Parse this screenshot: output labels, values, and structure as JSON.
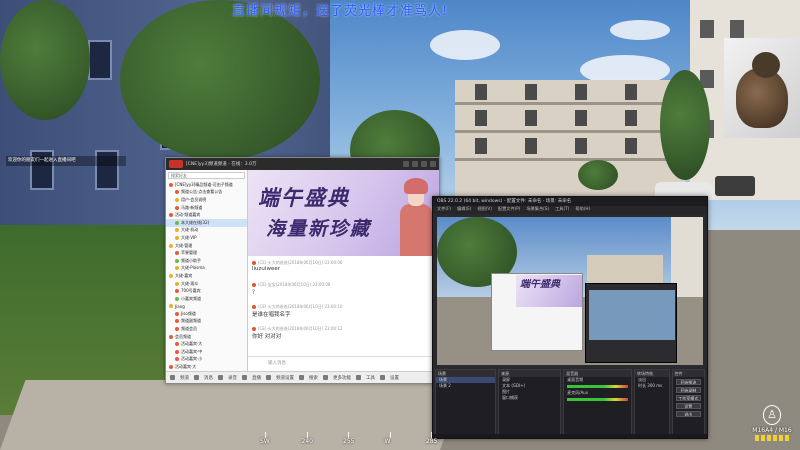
{
  "overlay": {
    "live_rule": "直播间规矩，送了荧光棒才准骂人!",
    "notice": "欢迎你的朋友们一起进入直播间吧"
  },
  "chat_window": {
    "title": "[CNE]yy3]频道频道 - 在线：3.0万",
    "search_placeholder": "搜索好友",
    "tree": [
      {
        "label": "[CNE]yy3]精品频道-可由子频道",
        "dot": "red"
      },
      {
        "label": "频道公告·点击查看公告",
        "dot": "red"
      },
      {
        "label": "用户·会员说明",
        "dot": "yellow"
      },
      {
        "label": "马路·新频道",
        "dot": "red"
      },
      {
        "label": "活动·频道嘉宾",
        "dot": "red"
      },
      {
        "label": "本大佬在线(32)",
        "dot": "green",
        "selected": true
      },
      {
        "label": "大佬·机动",
        "dot": "yellow"
      },
      {
        "label": "大佬·VIP",
        "dot": "yellow"
      },
      {
        "label": "大佬·管理",
        "dot": "yellow"
      },
      {
        "label": "苹果管理",
        "dot": "red"
      },
      {
        "label": "频道小助手",
        "dot": "green"
      },
      {
        "label": "大佬·Plasma",
        "dot": "yellow"
      },
      {
        "label": "大佬·嘉宾",
        "dot": "yellow"
      },
      {
        "label": "大佬·观众",
        "dot": "yellow"
      },
      {
        "label": "700号嘉宾",
        "dot": "red"
      },
      {
        "label": "小嘉宾频道",
        "dot": "green"
      },
      {
        "label": "Jiang",
        "dot": "yellow"
      },
      {
        "label": "Jiso频道",
        "dot": "red"
      },
      {
        "label": "频道副频道",
        "dot": "red"
      },
      {
        "label": "频道会员",
        "dot": "red"
      },
      {
        "label": "会员频道",
        "dot": "red"
      },
      {
        "label": "活动嘉宾·大",
        "dot": "red"
      },
      {
        "label": "活动嘉宾·中",
        "dot": "red"
      },
      {
        "label": "活动嘉宾·小",
        "dot": "red"
      },
      {
        "label": "活动嘉宾·大",
        "dot": "red"
      },
      {
        "label": "活动嘉宾·中",
        "dot": "red"
      }
    ],
    "banner": {
      "line1": "端午盛典",
      "line2": "海量新珍藏"
    },
    "messages": [
      {
        "meta": "(CE)·火大的爸爸(2018年06月10日) 23:00:06",
        "body": "liuzuiweer"
      },
      {
        "meta": "(CE)·宝宝(2018年06月10日) 23:00:08",
        "body": "？"
      },
      {
        "meta": "(CE)·火大的爸爸(2018年06月10日) 23:00:10",
        "body": "是谁在唱我名字"
      },
      {
        "meta": "(CE)·火大的爸爸(2018年06月10日) 23:00:12",
        "body": "你好 对对对"
      }
    ],
    "input_placeholder": "输入消息",
    "toolbar": [
      "频道",
      "消息",
      "录音",
      "直播",
      "频道设置",
      "搜索",
      "更多功能",
      "工具",
      "设置"
    ]
  },
  "obs_window": {
    "title": "OBS 22.0.2 (64 bit, windows) - 配置文件: 未命名 - 场景: 未命名",
    "menu": [
      "文件(F)",
      "编辑(E)",
      "视图(V)",
      "配置文件(P)",
      "场景集合(S)",
      "工具(T)",
      "帮助(H)"
    ],
    "docks": {
      "scenes": {
        "title": "场景",
        "items": [
          "场景",
          "场景 2"
        ]
      },
      "sources": {
        "title": "来源",
        "items": [
          "录屏",
          "文本 (GDI+)",
          "图片",
          "窗口捕获"
        ]
      },
      "mixer": {
        "title": "混音器",
        "items": [
          "桌面音频",
          "麦克风/Aux"
        ]
      },
      "transitions": {
        "title": "转场特效",
        "items": [
          "淡出",
          "时长 300 ms"
        ]
      },
      "controls": {
        "title": "控件",
        "buttons": [
          "开始推流",
          "开始录制",
          "工作室模式",
          "设置",
          "退出"
        ]
      }
    }
  },
  "hud": {
    "compass": [
      {
        "label": "SW",
        "bearing": 225
      },
      {
        "label": "240",
        "bearing": 240
      },
      {
        "label": "255",
        "bearing": 255
      },
      {
        "label": "W",
        "bearing": 270
      },
      {
        "label": "285",
        "bearing": 285
      }
    ],
    "fire_mode": "M16A4 / M16",
    "stance": "站立",
    "ammo_pips": 6
  }
}
